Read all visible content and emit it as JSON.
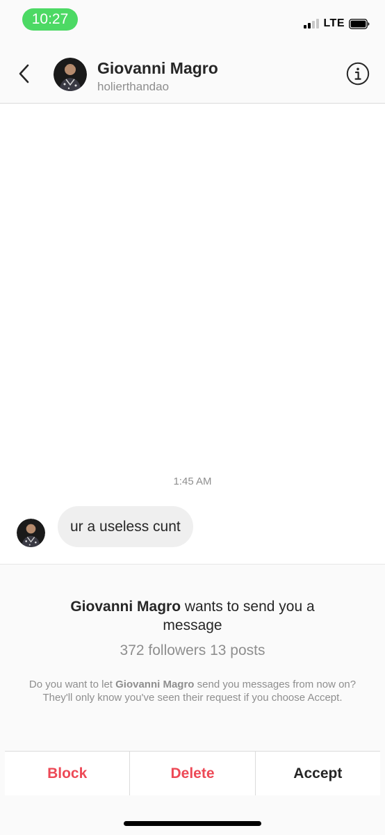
{
  "status_bar": {
    "time": "10:27",
    "network": "LTE",
    "signal_icon": "signal-bars-icon",
    "battery_icon": "battery-icon",
    "time_pill_color": "#4cd964"
  },
  "header": {
    "back_icon": "chevron-left-icon",
    "name": "Giovanni Magro",
    "username": "holierthandao",
    "info_icon": "info-icon"
  },
  "conversation": {
    "timestamp": "1:45 AM",
    "messages": [
      {
        "text": "ur a useless cunt"
      }
    ]
  },
  "request": {
    "title_name": "Giovanni Magro",
    "title_rest": " wants to send you a message",
    "stats": "372 followers 13 posts",
    "desc_prefix": "Do you want to let ",
    "desc_name": "Giovanni Magro",
    "desc_suffix": " send you messages from now on? They'll only know you've seen their request if you choose Accept.",
    "actions": {
      "block": "Block",
      "delete": "Delete",
      "accept": "Accept"
    }
  },
  "colors": {
    "destructive": "#ed4956",
    "primary_text": "#262626",
    "secondary_text": "#8e8e8e"
  }
}
